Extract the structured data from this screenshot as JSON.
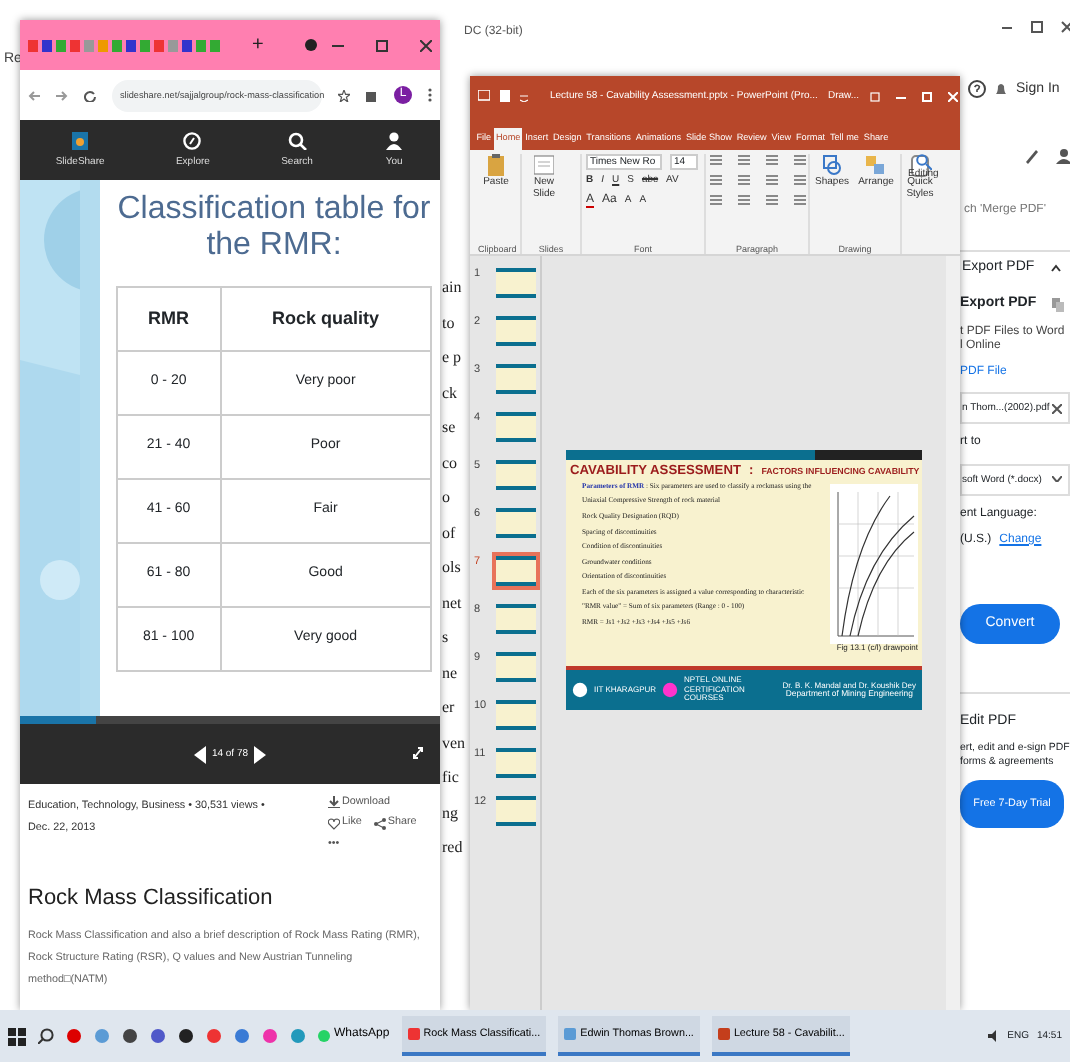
{
  "background_doc": {
    "title": "DC (32-bit)",
    "tab_fragment": "Re",
    "fragments": [
      "ain",
      "to",
      "e p",
      "ck",
      "se",
      "co",
      "o",
      "of",
      "ols",
      "net",
      "s",
      "ne",
      "er",
      "ven",
      "fic",
      "ng",
      "red"
    ]
  },
  "acrobat": {
    "sign_in": "Sign In",
    "search_placeholder": "ch 'Merge PDF'",
    "export_header": "Export PDF",
    "export_title": "Export PDF",
    "export_desc": [
      "t PDF Files to Word",
      "l Online"
    ],
    "file_label": "PDF File",
    "file_name": "n Thom...(2002).pdf",
    "convert_label": "rt to",
    "format": "soft Word (*.docx)",
    "lang_label": "ent Language:",
    "lang_value": "(U.S.)",
    "lang_change": "Change",
    "convert_button": "Convert",
    "edit_header": "Edit PDF",
    "edit_desc": [
      "ert, edit and e-sign PDF",
      "forms & agreements"
    ],
    "trial_button": "Free 7-Day Trial"
  },
  "browser": {
    "new_tab": "+",
    "url": "slideshare.net/sajjalgroup/rock-mass-classification",
    "avatar": "L",
    "nav": [
      {
        "label": "SlideShare",
        "kind": "logo"
      },
      {
        "label": "Explore",
        "kind": "explore"
      },
      {
        "label": "Search",
        "kind": "search"
      },
      {
        "label": "You",
        "kind": "user"
      }
    ],
    "slide": {
      "title": "Classification table for the RMR:",
      "columns": [
        "RMR",
        "Rock quality"
      ],
      "rows": [
        [
          "0 - 20",
          "Very poor"
        ],
        [
          "21 - 40",
          "Poor"
        ],
        [
          "41 - 60",
          "Fair"
        ],
        [
          "61 - 80",
          "Good"
        ],
        [
          "81 - 100",
          "Very good"
        ]
      ]
    },
    "progress": {
      "level": 0.18
    },
    "counter": "14 of 78",
    "meta": "Education, Technology, Business • 30,531 views •",
    "date": "Dec. 22, 2013",
    "actions": [
      "Download",
      "Like",
      "Share",
      "•••"
    ],
    "title": "Rock Mass Classification",
    "description": "Rock Mass Classification and also a brief description of Rock Mass Rating (RMR), Rock Structure Rating (RSR), Q values and New Austrian Tunneling method□(NATM)"
  },
  "powerpoint": {
    "title": "Lecture 58 - Cavability Assessment.pptx - PowerPoint (Pro...",
    "draw_tab": "Draw...",
    "tabs": [
      {
        "label": "File",
        "selected": false
      },
      {
        "label": "Home",
        "selected": true
      },
      {
        "label": "Insert",
        "selected": false
      },
      {
        "label": "Design",
        "selected": false
      },
      {
        "label": "Transitions",
        "selected": false
      },
      {
        "label": "Animations",
        "selected": false
      },
      {
        "label": "Slide Show",
        "selected": false
      },
      {
        "label": "Review",
        "selected": false
      },
      {
        "label": "View",
        "selected": false
      },
      {
        "label": "Format",
        "selected": false
      },
      {
        "label": "Tell me",
        "selected": false
      },
      {
        "label": "Share",
        "selected": false
      }
    ],
    "ribbon": {
      "paste": "Paste",
      "new_slide": "New Slide",
      "font": "Times New Ro",
      "size": "14",
      "font_buttons": [
        "B",
        "I",
        "U",
        "S",
        "abc",
        "AV"
      ],
      "font_buttons2": [
        "A",
        "Aa",
        "A",
        "A"
      ],
      "shapes": "Shapes",
      "arrange": "Arrange",
      "quick_styles": "Quick Styles",
      "editing": "Editing",
      "groups": [
        "Clipboard",
        "Slides",
        "Font",
        "Paragraph",
        "Drawing"
      ]
    },
    "thumbnails": [
      {
        "number": "1",
        "selected": false
      },
      {
        "number": "2",
        "selected": false
      },
      {
        "number": "3",
        "selected": false
      },
      {
        "number": "4",
        "selected": false
      },
      {
        "number": "5",
        "selected": false
      },
      {
        "number": "6",
        "selected": false
      },
      {
        "number": "7",
        "selected": true
      },
      {
        "number": "8",
        "selected": false
      },
      {
        "number": "9",
        "selected": false
      },
      {
        "number": "10",
        "selected": false
      },
      {
        "number": "11",
        "selected": false
      },
      {
        "number": "12",
        "selected": false
      }
    ],
    "slide": {
      "heading": "CAVABILITY ASSESSMENT",
      "heading_sep": ":",
      "subheading": "FACTORS INFLUENCING CAVABILITY",
      "lines": [
        "**Parameters of RMR** : Six parameters are used to classify a rockmass using the",
        "Uniaxial Compressive Strength of rock material",
        "Rock Quality Designation (RQD)",
        "Spacing of discontinuities",
        "Condition of discontinuities",
        "Groundwater conditions",
        "Orientation of discontinuities",
        "Each of the six parameters is assigned a value corresponding to characteristic",
        "\"RMR value\" = Sum of six parameters (Range : 0 - 100)",
        "RMR = Js1 +Js2 +Js3 +Js4 +Js5 +Js6"
      ],
      "caption": "Fig 13.1 (c/l) drawpoint",
      "footer": [
        "IIT KHARAGPUR",
        "NPTEL ONLINE CERTIFICATION COURSES"
      ],
      "authors": "Dr. B. K. Mandal and Dr. Koushik Dey",
      "department": "Department of Mining Engineering"
    }
  },
  "taskbar": {
    "pinned": "WhatsApp",
    "windows": [
      "Rock Mass Classificati...",
      "Edwin Thomas Brown...",
      "Lecture 58 - Cavabilit..."
    ],
    "language": "ENG",
    "time": "14:51"
  }
}
